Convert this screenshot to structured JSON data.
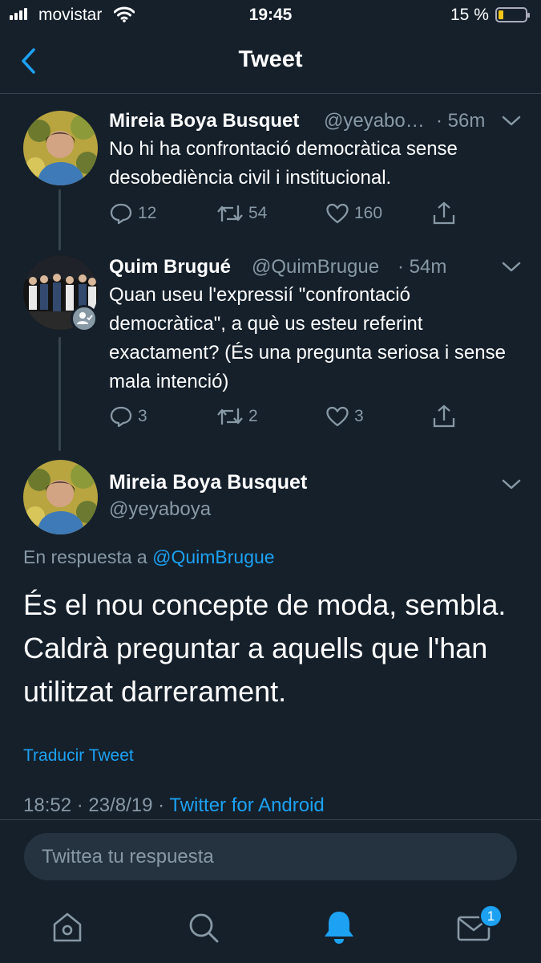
{
  "status_bar": {
    "carrier": "movistar",
    "time": "19:45",
    "battery": "15 %"
  },
  "header": {
    "title": "Tweet"
  },
  "thread": [
    {
      "name": "Mireia Boya Busquet",
      "handle": "@yeyabo…",
      "time": "· 56m",
      "text": "No hi ha confrontació democràtica sense desobediència civil i institucional.",
      "replies": "12",
      "retweets": "54",
      "likes": "160"
    },
    {
      "name": "Quim Brugué",
      "handle": "@QuimBrugue",
      "time": "· 54m",
      "text": "Quan useu l'expressií \"confrontació democràtica\", a què us esteu referint exactament? (És una pregunta seriosa i sense mala intenció)",
      "replies": "3",
      "retweets": "2",
      "likes": "3"
    }
  ],
  "main_tweet": {
    "name": "Mireia Boya Busquet",
    "handle": "@yeyaboya",
    "reply_prefix": "En respuesta a",
    "reply_to": "@QuimBrugue",
    "text": "És el nou concepte de moda, sembla. Caldrà preguntar a aquells que l'han utilitzat darrerament.",
    "translate": "Traducir Tweet",
    "timestamp": "18:52 · 23/8/19 ·",
    "source": "Twitter for Android"
  },
  "compose": {
    "placeholder": "Twittea tu respuesta"
  },
  "tab_bar": {
    "messages_badge": "1"
  },
  "colors": {
    "background": "#15202b",
    "accent": "#1da1f2",
    "muted": "#8899a6",
    "divider": "#38444d"
  }
}
